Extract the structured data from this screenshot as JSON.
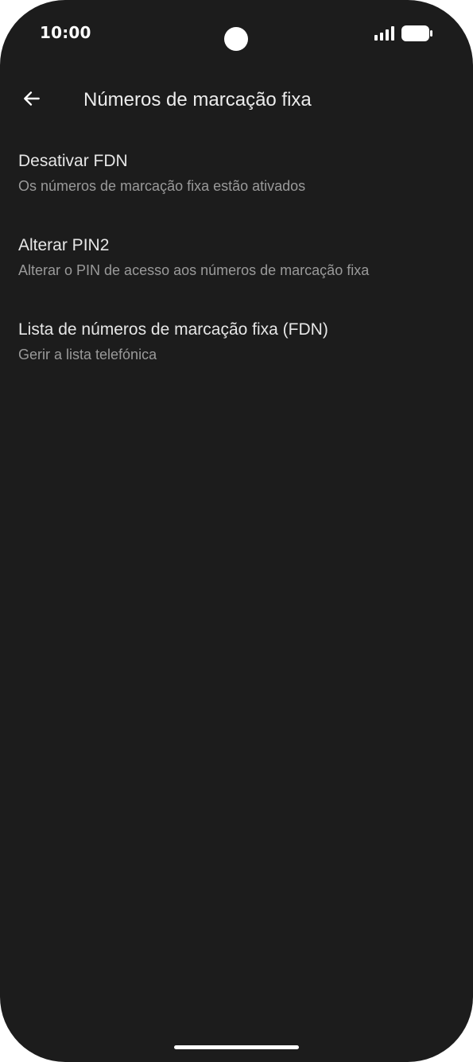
{
  "status_bar": {
    "time": "10:00",
    "signal_icon": "signal-icon",
    "battery_icon": "battery-icon"
  },
  "app_bar": {
    "back_icon": "arrow-left-icon",
    "title": "Números de marcação fixa"
  },
  "settings": [
    {
      "title": "Desativar FDN",
      "subtitle": "Os números de marcação fixa estão ativados"
    },
    {
      "title": "Alterar PIN2",
      "subtitle": "Alterar o PIN de acesso aos números de marcação fixa"
    },
    {
      "title": "Lista de números de marcação fixa (FDN)",
      "subtitle": "Gerir a lista telefónica"
    }
  ],
  "colors": {
    "background": "#1c1c1c",
    "title_text": "#e6e6e6",
    "subtitle_text": "#9a9a9a"
  }
}
